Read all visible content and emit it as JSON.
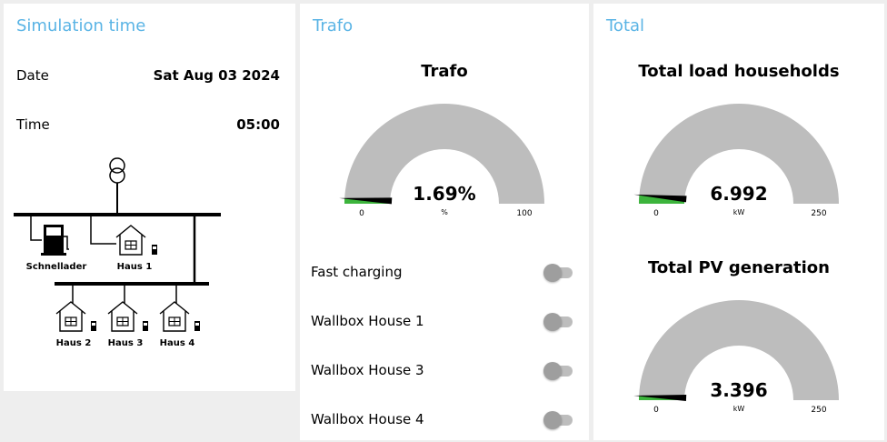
{
  "sim": {
    "title": "Simulation time",
    "date_label": "Date",
    "date_value": "Sat Aug 03 2024",
    "time_label": "Time",
    "time_value": "05:00",
    "schematic": {
      "schnelllader": "Schnellader",
      "haus1": "Haus 1",
      "haus2": "Haus 2",
      "haus3": "Haus 3",
      "haus4": "Haus 4"
    }
  },
  "trafo": {
    "title": "Trafo",
    "gauge": {
      "title": "Trafo",
      "value": 1.69,
      "value_text": "1.69%",
      "unit": "%",
      "min": "0",
      "max": "100",
      "min_num": 0,
      "max_num": 100
    },
    "toggles": [
      {
        "label": "Fast charging",
        "on": false
      },
      {
        "label": "Wallbox House 1",
        "on": false
      },
      {
        "label": "Wallbox House 3",
        "on": false
      },
      {
        "label": "Wallbox House 4",
        "on": false
      }
    ]
  },
  "total": {
    "title": "Total",
    "load": {
      "title": "Total load households",
      "value": 6.992,
      "value_text": "6.992",
      "unit": "kW",
      "min": "0",
      "max": "250",
      "min_num": 0,
      "max_num": 250
    },
    "pv": {
      "title": "Total PV generation",
      "value": 3.396,
      "value_text": "3.396",
      "unit": "kW",
      "min": "0",
      "max": "250",
      "min_num": 0,
      "max_num": 250
    }
  },
  "colors": {
    "accent": "#5ab4e5",
    "gauge_track": "#bdbdbd",
    "gauge_fill": "#3cb43c",
    "needle": "#000000",
    "toggle_knob": "#9e9e9e",
    "toggle_track": "#bdbdbd"
  }
}
